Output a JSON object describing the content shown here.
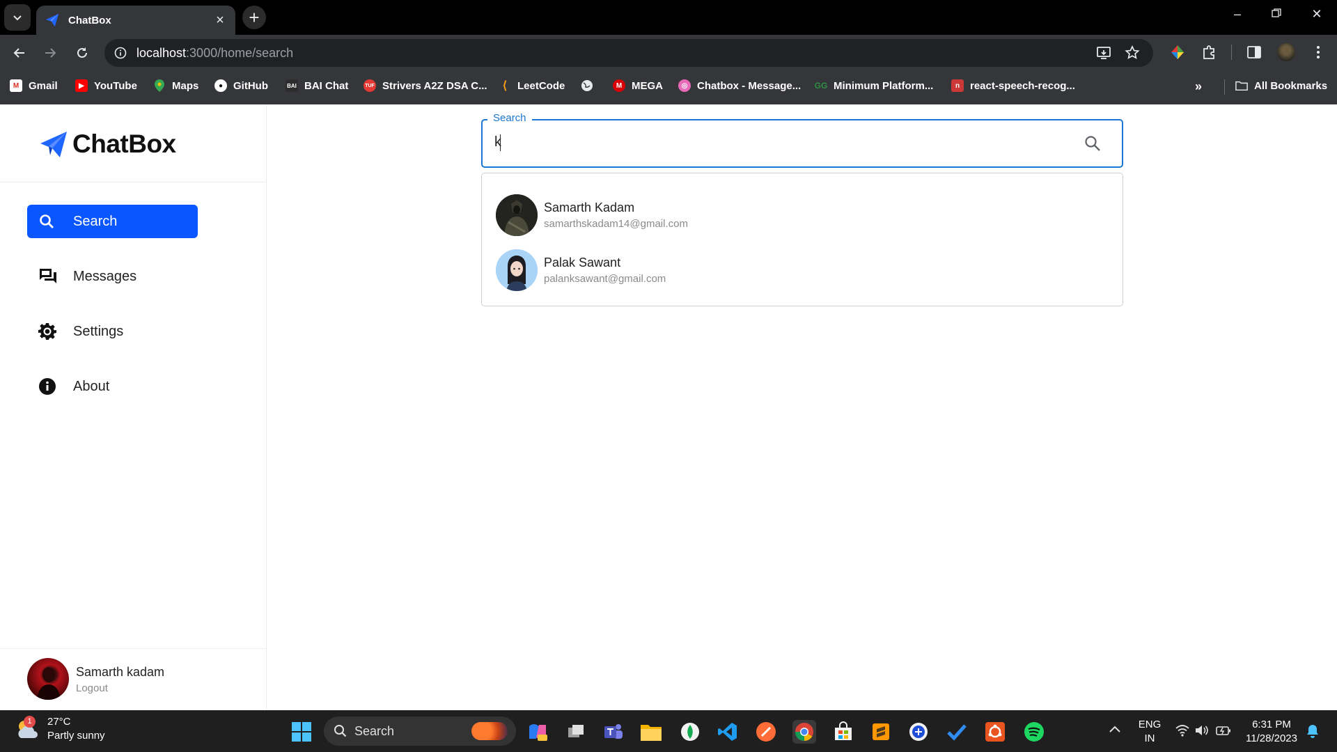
{
  "browser": {
    "tab_title": "ChatBox",
    "url_host": "localhost",
    "url_path": ":3000/home/search",
    "bookmarks": [
      "Gmail",
      "YouTube",
      "Maps",
      "GitHub",
      "BAI Chat",
      "Strivers A2Z DSA C...",
      "LeetCode",
      "MEGA",
      "Chatbox - Message...",
      "Minimum Platform...",
      "react-speech-recog..."
    ],
    "all_bookmarks_label": "All Bookmarks"
  },
  "app": {
    "logo_text": "ChatBox",
    "nav": [
      {
        "label": "Search",
        "icon": "search-icon",
        "active": true
      },
      {
        "label": "Messages",
        "icon": "chat-bubbles-icon",
        "active": false
      },
      {
        "label": "Settings",
        "icon": "gear-icon",
        "active": false
      },
      {
        "label": "About",
        "icon": "info-icon",
        "active": false
      }
    ],
    "current_user": {
      "name": "Samarth kadam",
      "logout_label": "Logout"
    },
    "search": {
      "legend": "Search",
      "value": "k"
    },
    "results": [
      {
        "name": "Samarth Kadam",
        "email": "samarthskadam14@gmail.com"
      },
      {
        "name": "Palak Sawant",
        "email": "palanksawant@gmail.com"
      }
    ]
  },
  "taskbar": {
    "weather_temp": "27°C",
    "weather_desc": "Partly sunny",
    "weather_badge": "1",
    "search_label": "Search",
    "language_line1": "ENG",
    "language_line2": "IN",
    "time": "6:31 PM",
    "date": "11/28/2023"
  },
  "colors": {
    "accent": "#0b57ff",
    "focus_outline": "#1976d2"
  }
}
